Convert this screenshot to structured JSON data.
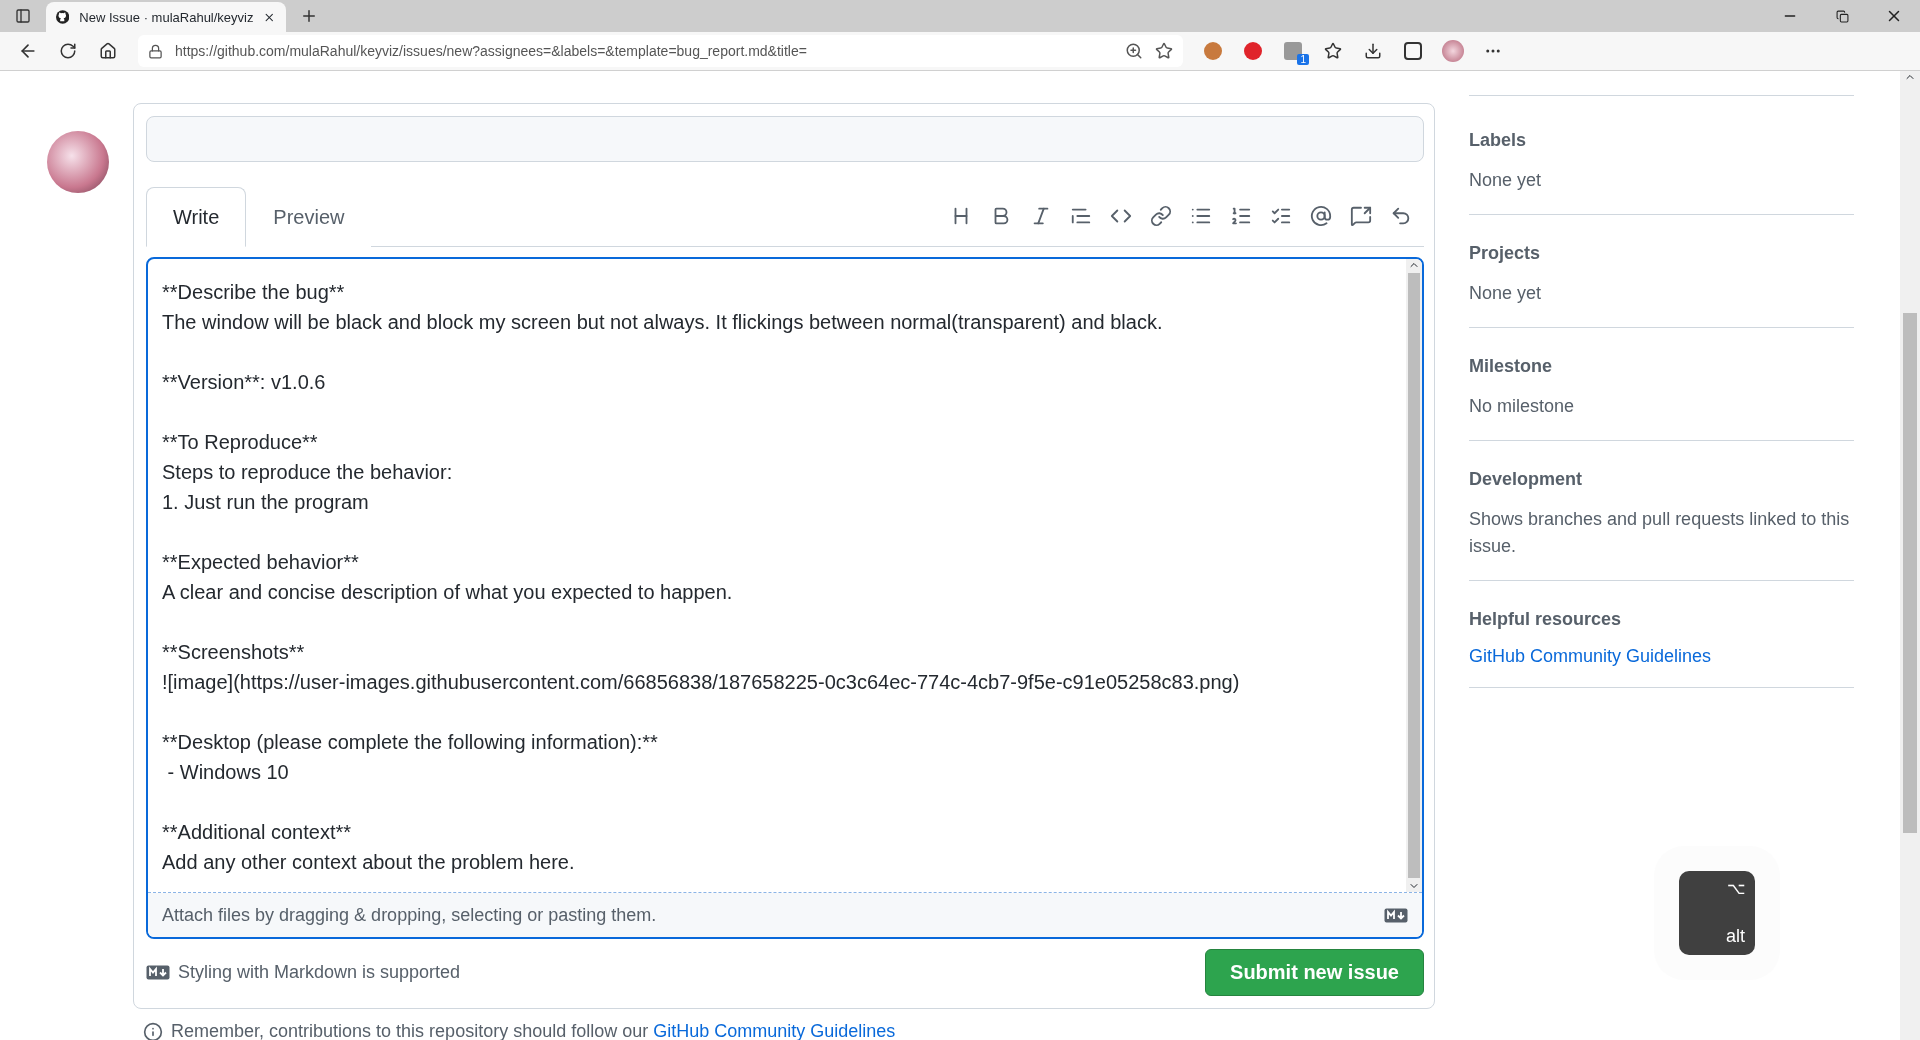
{
  "browser": {
    "tab_title": "New Issue · mulaRahul/keyviz",
    "url": "https://github.com/mulaRahul/keyviz/issues/new?assignees=&labels=&template=bug_report.md&title=",
    "extension_badge": "1"
  },
  "editor": {
    "tabs": [
      {
        "label": "Write",
        "selected": true
      },
      {
        "label": "Preview",
        "selected": false
      }
    ],
    "blocks": [
      [
        "**Describe the bug**",
        "The window will be black and block my screen but not always. It flickings between normal(transparent) and black."
      ],
      [
        "**Version**: v1.0.6"
      ],
      [
        "**To Reproduce**",
        "Steps to reproduce the behavior:",
        "1. Just run the program"
      ],
      [
        "**Expected behavior**",
        "A clear and concise description of what you expected to happen."
      ],
      [
        "**Screenshots**",
        "![image](https://user-images.githubusercontent.com/66856838/187658225-0c3c64ec-774c-4cb7-9f5e-c91e05258c83.png)"
      ],
      [
        "**Desktop (please complete the following information):**",
        " - Windows 10"
      ],
      [
        "**Additional context**",
        "Add any other context about the problem here."
      ]
    ],
    "attach_hint": "Attach files by dragging & dropping, selecting or pasting them.",
    "markdown_note": "Styling with Markdown is supported",
    "submit_button": "Submit new issue"
  },
  "footer_note": {
    "text": "Remember, contributions to this repository should follow our",
    "link": "GitHub Community Guidelines"
  },
  "sidebar": [
    {
      "heading": "Labels",
      "value": "None yet",
      "kind": "text"
    },
    {
      "heading": "Projects",
      "value": "None yet",
      "kind": "text"
    },
    {
      "heading": "Milestone",
      "value": "No milestone",
      "kind": "text"
    },
    {
      "heading": "Development",
      "value": "Shows branches and pull requests linked to this issue.",
      "kind": "text"
    },
    {
      "heading": "Helpful resources",
      "value": "GitHub Community Guidelines",
      "kind": "link"
    }
  ],
  "key_overlay": {
    "symbol": "⌥",
    "label": "alt"
  }
}
